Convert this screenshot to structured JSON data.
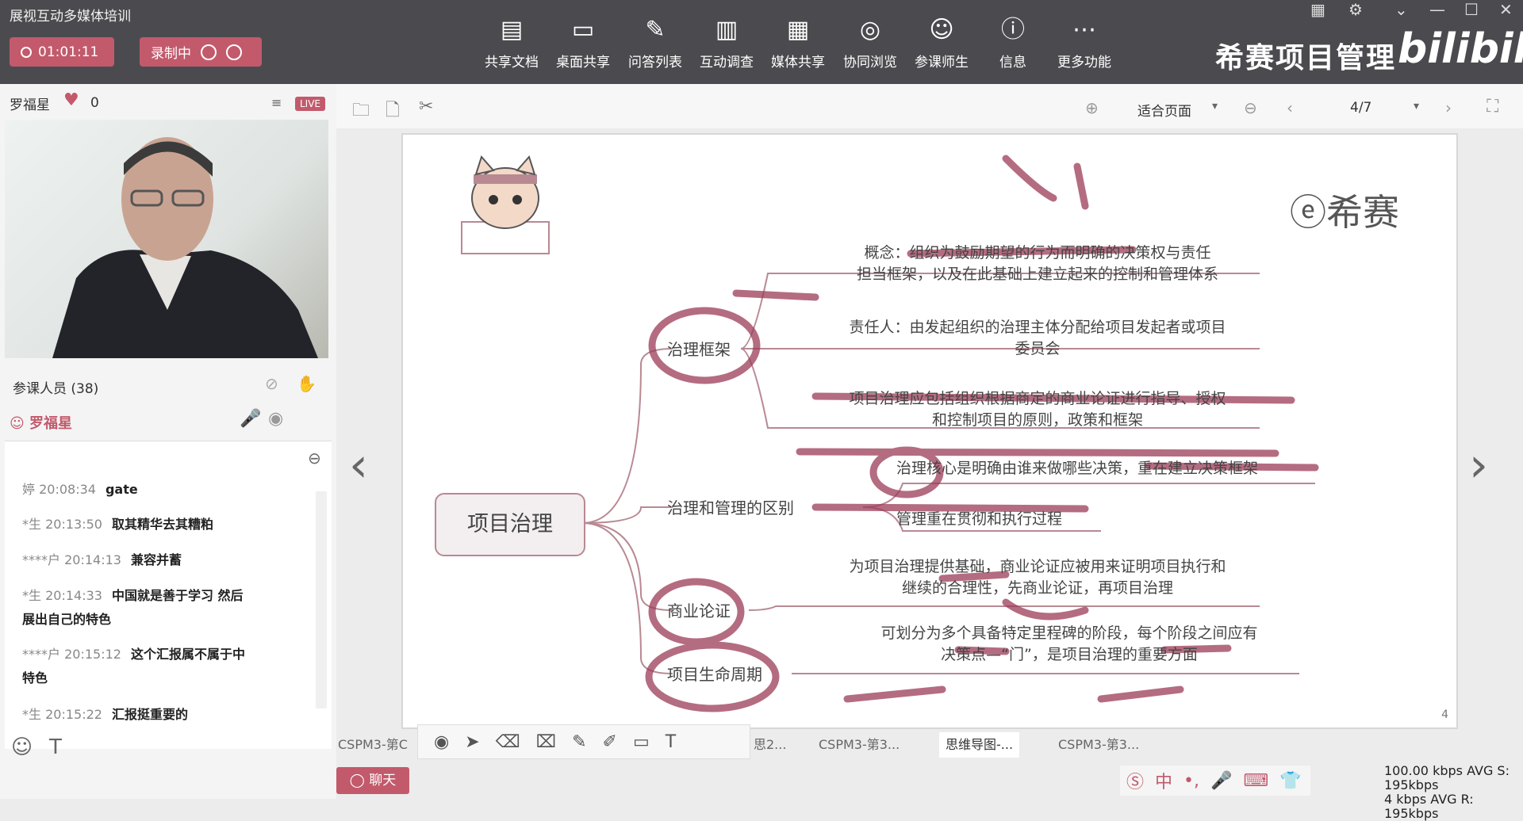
{
  "app_title": "展视互动多媒体培训",
  "timer": "01:01:11",
  "recording_label": "录制中",
  "toolbar": [
    {
      "icon": "document-icon",
      "glyph": "▤",
      "label": "共享文档"
    },
    {
      "icon": "desktop-share-icon",
      "glyph": "▭",
      "label": "桌面共享"
    },
    {
      "icon": "qa-list-icon",
      "glyph": "✎",
      "label": "问答列表"
    },
    {
      "icon": "survey-icon",
      "glyph": "▥",
      "label": "互动调查"
    },
    {
      "icon": "media-share-icon",
      "glyph": "▦",
      "label": "媒体共享"
    },
    {
      "icon": "browse-icon",
      "glyph": "◎",
      "label": "协同浏览"
    },
    {
      "icon": "participants-icon",
      "glyph": "☺",
      "label": "参课师生"
    },
    {
      "icon": "info-icon",
      "glyph": "ⓘ",
      "label": "信息"
    },
    {
      "icon": "more-icon",
      "glyph": "⋯",
      "label": "更多功能"
    }
  ],
  "brand": "希赛项目管理",
  "bilibili": "bilibili",
  "host": {
    "name": "罗福星",
    "likes": "0",
    "live": "LIVE"
  },
  "participants": {
    "title": "参课人员 (38)",
    "current": "罗福星"
  },
  "chat": [
    {
      "user": "婷",
      "time": "20:08:34",
      "text": "gate"
    },
    {
      "user": "*生",
      "time": "20:13:50",
      "text": "取其精华去其糟粕"
    },
    {
      "user": "****户",
      "time": "20:14:13",
      "text": "兼容并蓄"
    },
    {
      "user": "*生",
      "time": "20:14:33",
      "text": "中国就是善于学习 然后",
      "text2": "展出自己的特色"
    },
    {
      "user": "****户",
      "time": "20:15:12",
      "text": "这个汇报属不属于中",
      "text2": "特色"
    },
    {
      "user": "*生",
      "time": "20:15:22",
      "text": "汇报挺重要的"
    }
  ],
  "doc": {
    "zoom": "适合页面",
    "page": "4/7"
  },
  "slide": {
    "logo": "希赛",
    "root": "项目治理",
    "branches": [
      "治理框架",
      "治理和管理的区别",
      "商业论证",
      "项目生命周期"
    ],
    "leaves": {
      "concept": [
        "概念：组织为鼓励期望的行为而明确的决策权与责任",
        "担当框架，以及在此基础上建立起来的控制和管理体系"
      ],
      "owner": [
        "责任人：由发起组织的治理主体分配给项目发起者或项目",
        "委员会"
      ],
      "include": [
        "项目治理应包括组织根据商定的商业论证进行指导、授权",
        "和控制项目的原则，政策和框架"
      ],
      "core": "治理核心是明确由谁来做哪些决策，重在建立决策框架",
      "mgmt": "管理重在贯彻和执行过程",
      "biz": [
        "为项目治理提供基础，商业论证应被用来证明项目执行和",
        "继续的合理性，先商业论证，再项目治理"
      ],
      "life": [
        "可划分为多个具备特定里程碑的阶段，每个阶段之间应有",
        "决策点—“门”，是项目治理的重要方面"
      ]
    },
    "page_number": "4"
  },
  "tabs": [
    "CSPM3-第C",
    "思2...",
    "CSPM3-第3...",
    "思维导图-...",
    "CSPM3-第3..."
  ],
  "chat_button": "聊天",
  "stats": {
    "line1": "100.00 kbps  AVG S: 195kbps",
    "line2": "4 kbps  AVG R: 195kbps"
  },
  "ime": "中"
}
